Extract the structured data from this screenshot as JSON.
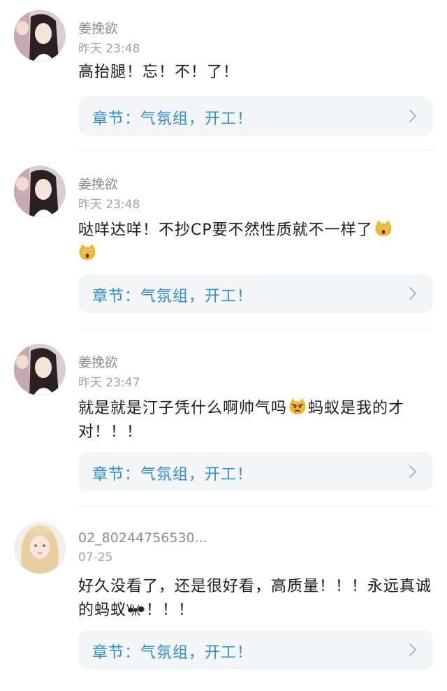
{
  "comments": [
    {
      "username": "姜挽欲",
      "time": "昨天 23:48",
      "text": "高抬腿！忘！不！了！",
      "chapter": "章节：气氛组，开工！",
      "avatar": "girl-dark-hair-avatar"
    },
    {
      "username": "姜挽欲",
      "time": "昨天 23:48",
      "text_parts": [
        "哒咩达咩！不抄CP要不然性质就不一样了"
      ],
      "emoji": "scared-cat-emoji",
      "chapter": "章节：气氛组，开工！",
      "avatar": "girl-dark-hair-avatar"
    },
    {
      "username": "姜挽欲",
      "time": "昨天 23:47",
      "text_parts": [
        "就是就是汀子凭什么啊帅气吗",
        "蚂蚁是我的才对！！！"
      ],
      "emoji": "angry-cat-emoji",
      "chapter": "章节：气氛组，开工！",
      "avatar": "girl-dark-hair-avatar"
    },
    {
      "username": "02_80244756530...",
      "time": "07-25",
      "text_parts": [
        "好久没看了，还是很好看，高质量！！！永远真诚的蚂蚁",
        "！！！"
      ],
      "emoji": "ant-emoji",
      "chapter": "章节：气氛组，开工！",
      "avatar": "girl-blonde-hair-avatar"
    }
  ],
  "colors": {
    "chapter_text": "#2f8fd6",
    "chapter_bg": "#f4f5f7",
    "meta_text": "#8c8c8c"
  }
}
